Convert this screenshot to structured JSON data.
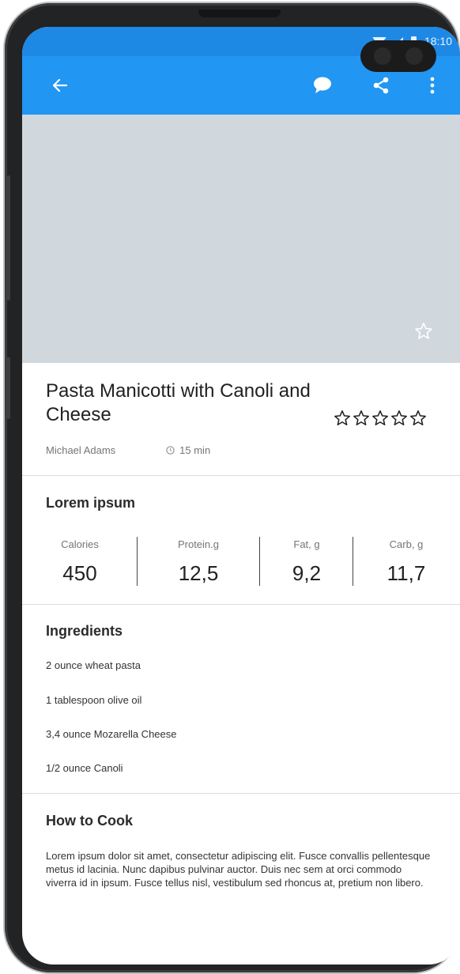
{
  "status_bar": {
    "time": "18:10"
  },
  "app_bar": {
    "icons": [
      "back-icon",
      "comment-icon",
      "share-icon",
      "more-icon"
    ],
    "color": "#2196f3"
  },
  "hero": {
    "placeholder_color": "#d0d8de",
    "favorite_icon": "star-outline-icon"
  },
  "recipe": {
    "title": "Pasta Manicotti with Canoli and Cheese",
    "author": "Michael Adams",
    "duration": "15 min",
    "rating": 0,
    "rating_max": 5
  },
  "nutrition": {
    "title": "Lorem ipsum",
    "items": [
      {
        "label": "Calories",
        "value": "450"
      },
      {
        "label": "Protein.g",
        "value": "12,5"
      },
      {
        "label": "Fat, g",
        "value": "9,2"
      },
      {
        "label": "Carb, g",
        "value": "11,7"
      }
    ]
  },
  "ingredients": {
    "title": "Ingredients",
    "items": [
      "2 ounce wheat pasta",
      "1 tablespoon olive oil",
      "3,4 ounce Mozarella Cheese",
      "1/2 ounce Canoli"
    ]
  },
  "how_to_cook": {
    "title": "How to Cook",
    "text": "Lorem ipsum dolor sit amet, consectetur adipiscing elit. Fusce convallis pellentesque metus id lacinia. Nunc dapibus pulvinar auctor. Duis nec sem at orci commodo viverra id in ipsum. Fusce tellus nisl, vestibulum sed rhoncus at, pretium non libero."
  }
}
